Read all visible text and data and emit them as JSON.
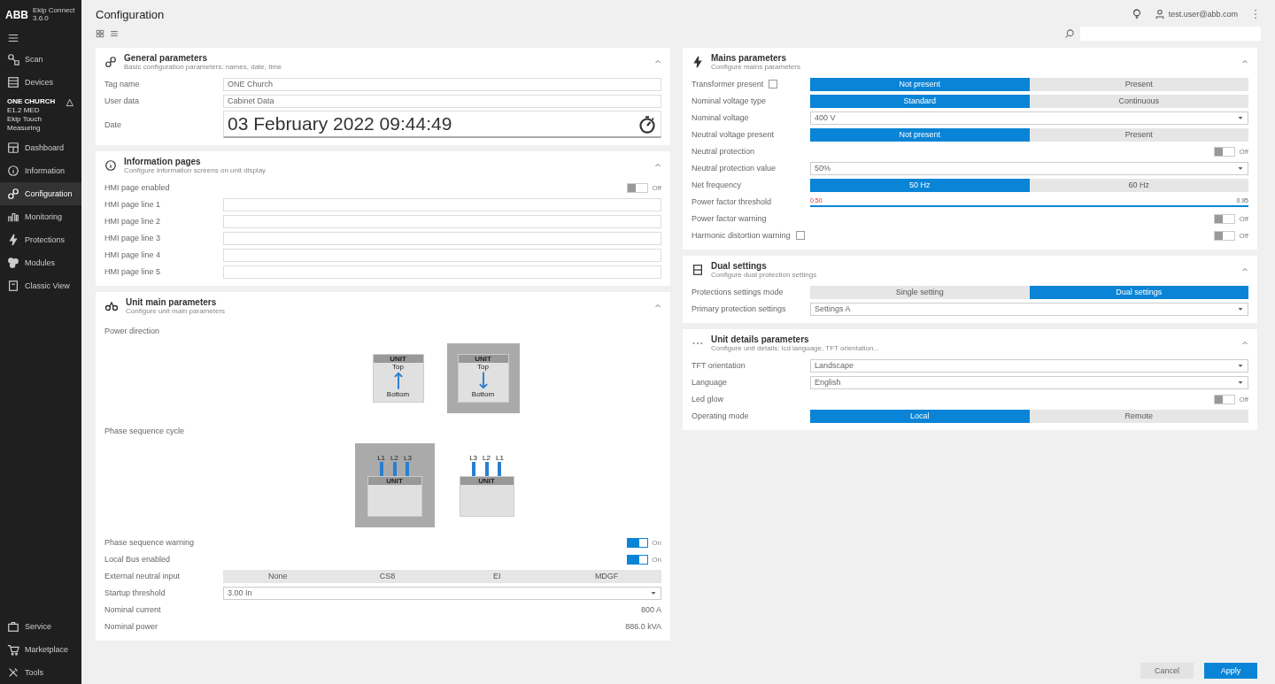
{
  "app": {
    "brand": "ABB",
    "name": "Ekip Connect",
    "version": "3.6.0"
  },
  "sidebar": {
    "items": [
      {
        "label": "Scan",
        "selected": false
      },
      {
        "label": "Devices",
        "selected": false
      }
    ],
    "device": {
      "lines": [
        "ONE CHURCH",
        "E1.2 MED",
        "Ekip Touch Measuring"
      ]
    },
    "nav": [
      {
        "label": "Dashboard",
        "selected": false
      },
      {
        "label": "Information",
        "selected": false
      },
      {
        "label": "Configuration",
        "selected": true
      },
      {
        "label": "Monitoring",
        "selected": false
      },
      {
        "label": "Protections",
        "selected": false
      },
      {
        "label": "Modules",
        "selected": false
      },
      {
        "label": "Classic View",
        "selected": false
      }
    ],
    "bottom": [
      {
        "label": "Service"
      },
      {
        "label": "Marketplace"
      },
      {
        "label": "Tools"
      }
    ]
  },
  "header": {
    "title": "Configuration",
    "user": "test.user@abb.com"
  },
  "columns": [
    {
      "panels": [
        {
          "title": "General parameters",
          "subtitle": "Basic configuration parameters: names, date, time",
          "rows": [
            {
              "kind": "input",
              "label": "Tag name",
              "value": "ONE Church"
            },
            {
              "kind": "input",
              "label": "User data",
              "value": "Cabinet Data"
            },
            {
              "kind": "date",
              "label": "Date",
              "value": "03 February 2022 09:44:49"
            }
          ]
        },
        {
          "title": "Information pages",
          "subtitle": "Configure information screens on unit display",
          "rows": [
            {
              "kind": "toggle",
              "label": "HMI page enabled",
              "on": false,
              "state": "Off"
            },
            {
              "kind": "input",
              "label": "HMI page line 1"
            },
            {
              "kind": "input",
              "label": "HMI page line 2"
            },
            {
              "kind": "input",
              "label": "HMI page line 3"
            },
            {
              "kind": "input",
              "label": "HMI page line 4"
            },
            {
              "kind": "input",
              "label": "HMI page line 5"
            }
          ]
        },
        {
          "title": "Unit main parameters",
          "subtitle": "Configure unit main parameters",
          "rows": [
            {
              "kind": "heading",
              "label": "Power direction"
            },
            {
              "kind": "direction",
              "options": [
                {
                  "header": "UNIT",
                  "top": "Top",
                  "bottom": "Bottom",
                  "kind": "up",
                  "selected": false
                },
                {
                  "header": "UNIT",
                  "top": "Top",
                  "bottom": "Bottom",
                  "kind": "down",
                  "selected": true
                }
              ]
            },
            {
              "kind": "heading",
              "label": "Phase sequence cycle"
            },
            {
              "kind": "phase",
              "options": [
                {
                  "header": "UNIT",
                  "phases": [
                    "L1",
                    "L2",
                    "L3"
                  ],
                  "selected": true
                },
                {
                  "header": "UNIT",
                  "phases": [
                    "L3",
                    "L2",
                    "L1"
                  ],
                  "selected": false
                }
              ]
            },
            {
              "kind": "toggle",
              "label": "Phase sequence warning",
              "on": true,
              "state": "On"
            },
            {
              "kind": "toggle",
              "label": "Local Bus enabled",
              "on": true,
              "state": "On"
            },
            {
              "kind": "segmented",
              "label": "External neutral input",
              "options": [
                {
                  "label": "None",
                  "selected": false
                },
                {
                  "label": "CS8",
                  "selected": false
                },
                {
                  "label": "EI",
                  "selected": false
                },
                {
                  "label": "MDGF",
                  "selected": false
                }
              ]
            },
            {
              "kind": "select",
              "label": "Startup threshold",
              "value": "3.00 In"
            },
            {
              "kind": "value",
              "label": "Nominal current",
              "value": "800 A"
            },
            {
              "kind": "value",
              "label": "Nominal power",
              "value": "886.0 kVA"
            }
          ]
        }
      ]
    },
    {
      "panels": [
        {
          "title": "Mains parameters",
          "subtitle": "Configure mains parameters",
          "rows": [
            {
              "kind": "segmented",
              "label": "Transformer present",
              "checkbox": {
                "checked": false
              },
              "options": [
                {
                  "label": "Not present",
                  "selected": true
                },
                {
                  "label": "Present",
                  "selected": false
                }
              ]
            },
            {
              "kind": "segmented",
              "label": "Nominal voltage type",
              "options": [
                {
                  "label": "Standard",
                  "selected": true
                },
                {
                  "label": "Continuous",
                  "selected": false
                }
              ]
            },
            {
              "kind": "select",
              "label": "Nominal voltage",
              "value": "400 V"
            },
            {
              "kind": "segmented",
              "label": "Neutral voltage present",
              "options": [
                {
                  "label": "Not present",
                  "selected": true
                },
                {
                  "label": "Present",
                  "selected": false
                }
              ]
            },
            {
              "kind": "toggle",
              "label": "Neutral protection",
              "on": false,
              "state": "Off"
            },
            {
              "kind": "select",
              "label": "Neutral protection value",
              "value": "50%"
            },
            {
              "kind": "segmented",
              "label": "Net frequency",
              "options": [
                {
                  "label": "50 Hz",
                  "selected": true
                },
                {
                  "label": "60 Hz",
                  "selected": false
                }
              ]
            },
            {
              "kind": "slider",
              "label": "Power factor threshold",
              "min": "0.50",
              "max": "0.95",
              "level": 1
            },
            {
              "kind": "toggle",
              "label": "Power factor warning",
              "on": false,
              "state": "Off"
            },
            {
              "kind": "toggle",
              "label": "Harmonic distortion warning",
              "checkbox": {
                "checked": false
              },
              "on": false,
              "state": "Off"
            }
          ]
        },
        {
          "title": "Dual settings",
          "subtitle": "Configure dual protection settings",
          "rows": [
            {
              "kind": "segmented",
              "label": "Protections settings mode",
              "options": [
                {
                  "label": "Single setting",
                  "selected": false
                },
                {
                  "label": "Dual settings",
                  "selected": true
                }
              ]
            },
            {
              "kind": "select",
              "label": "Primary protection settings",
              "value": "Settings A"
            }
          ]
        },
        {
          "title": "Unit details parameters",
          "subtitle": "Configure unit details: lcd language, TFT orientation...",
          "rows": [
            {
              "kind": "select",
              "label": "TFT orientation",
              "value": "Landscape"
            },
            {
              "kind": "select",
              "label": "Language",
              "value": "English"
            },
            {
              "kind": "toggle",
              "label": "Led glow",
              "on": false,
              "state": "Off"
            },
            {
              "kind": "segmented",
              "label": "Operating mode",
              "options": [
                {
                  "label": "Local",
                  "selected": true
                },
                {
                  "label": "Remote",
                  "selected": false
                }
              ]
            }
          ]
        }
      ]
    }
  ],
  "footer": {
    "buttons": [
      {
        "label": "Cancel",
        "kind": "secondary"
      },
      {
        "label": "Apply",
        "kind": "primary"
      }
    ]
  }
}
